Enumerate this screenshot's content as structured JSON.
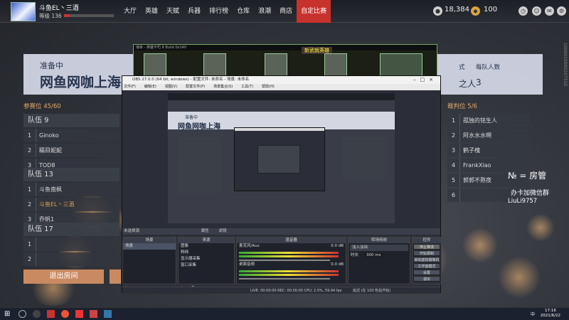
{
  "topbar": {
    "username": "斗鱼EL丶三酒",
    "level": "等级 136",
    "nav": [
      "大厅",
      "英雄",
      "天赋",
      "兵器",
      "排行榜",
      "仓库",
      "浪潮",
      "商店",
      "自定比赛"
    ],
    "active_nav": "自定比赛",
    "currency1": "18,384",
    "currency2": "100",
    "side_tag": "1000010000107510"
  },
  "room": {
    "status": "准备中",
    "name": "网鱼网咖上海",
    "meta_label_1": "式",
    "meta_label_2": "每队人数",
    "meta_value_1": "之人",
    "meta_value_2": "3"
  },
  "participants": {
    "header": "参赛位 45/60",
    "teams": [
      {
        "name": "队伍 9",
        "players": [
          {
            "n": "1",
            "p": "Ginoko"
          },
          {
            "n": "2",
            "p": "糯目妮妮"
          },
          {
            "n": "3",
            "p": "TOD8"
          }
        ]
      },
      {
        "name": "队伍 13",
        "players": [
          {
            "n": "1",
            "p": "斗鱼南枫"
          },
          {
            "n": "2",
            "p": "斗鱼EL丶三酒"
          },
          {
            "n": "3",
            "p": "乔帆1"
          }
        ]
      },
      {
        "name": "队伍 17",
        "players": [
          {
            "n": "1",
            "p": ""
          },
          {
            "n": "2",
            "p": ""
          }
        ]
      }
    ],
    "exit_button": "退出房间"
  },
  "referees": {
    "header": "裁判位 5/6",
    "rows": [
      {
        "n": "1",
        "p": "孤独的铭生人"
      },
      {
        "n": "2",
        "p": "阿水水水啊"
      },
      {
        "n": "3",
        "p": "鹤子槐"
      },
      {
        "n": "4",
        "p": "FrankXiao"
      },
      {
        "n": "5",
        "p": "郭郭不熬夜"
      },
      {
        "n": "6",
        "p": ""
      }
    ]
  },
  "overlay": {
    "line1": "№ = 房管",
    "line2": "办卡加微信群",
    "line3": "LiuLi9757"
  },
  "game_preview": {
    "title_bar": "瑞幸 - 英雄不朽 8 Build 0x140",
    "highlight": "新武就英雄"
  },
  "obs": {
    "title": "OBS 27.0.0 (64 bit, windows) - 配置文件: 未命名 - 场景: 未命名",
    "menu": [
      "文件(F)",
      "编辑(E)",
      "视图(V)",
      "配置文件(P)",
      "场景集合(S)",
      "工具(T)",
      "帮助(H)"
    ],
    "preview_bar": "未选择源",
    "props": "属性",
    "filters": "滤镜",
    "scenes_header": "场景",
    "scenes": [
      "场景"
    ],
    "sources_header": "来源",
    "sources": [
      "图像",
      "斜线",
      "显示器采集",
      "窗口采集"
    ],
    "mixer_header": "混音器",
    "mixer": [
      {
        "name": "麦克风/Aux",
        "db": "0.0 dB"
      },
      {
        "name": "桌面音频",
        "db": "0.0 dB"
      }
    ],
    "transition_header": "转场特效",
    "transition_value": "淡入淡出",
    "duration_label": "时长",
    "duration_value": "300 ms",
    "controls_header": "控件",
    "controls": [
      "停止推流",
      "开始录制",
      "启动虚拟摄像机",
      "工作室模式",
      "设置",
      "退出"
    ],
    "status": "LIVE: 00:00:00   REC: 00:00:00   CPU: 2.5%, 59.94 fps",
    "streaming_note": "延迟 (在 100 秒后开始)"
  },
  "taskbar": {
    "time": "17:16",
    "date": "2021/6/22",
    "lang": "中"
  },
  "colors": {
    "accent": "#c8322c",
    "highlight_player": "#e0a050",
    "section_title": "#e1a86a"
  }
}
